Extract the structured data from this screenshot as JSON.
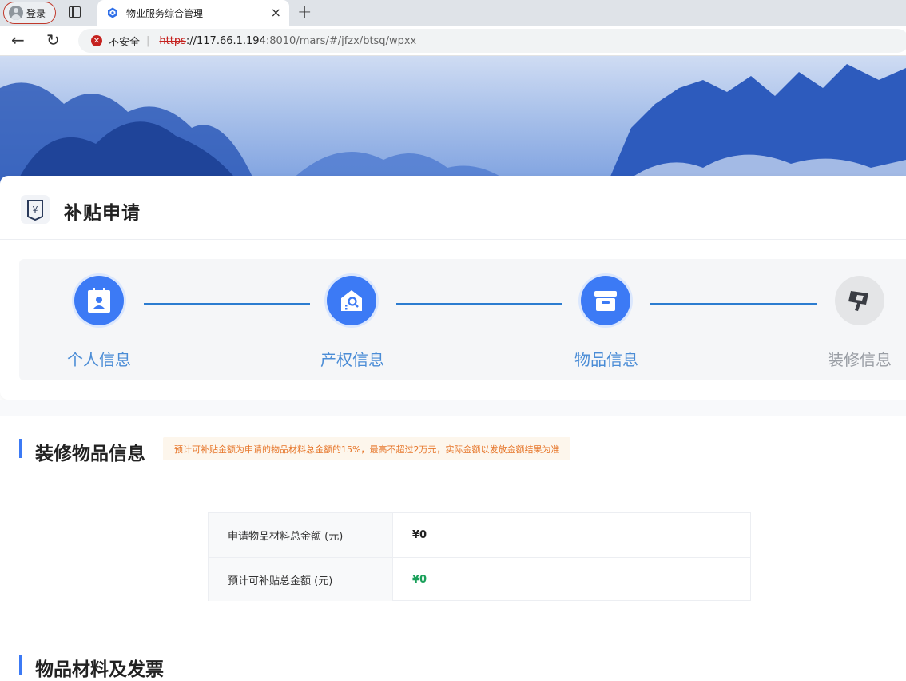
{
  "browser": {
    "login_label": "登录",
    "tab_title": "物业服务综合管理",
    "tab_close_glyph": "×",
    "new_tab_glyph": "+",
    "back_glyph": "←",
    "reload_glyph": "↻",
    "security_label": "不安全",
    "url_scheme": "https",
    "url_host": "://117.66.1.194",
    "url_path": ":8010/mars/#/jfzx/btsq/wpxx"
  },
  "page": {
    "title": "补贴申请",
    "steps": [
      {
        "label": "个人信息",
        "icon": "id-card-icon",
        "state": "active"
      },
      {
        "label": "产权信息",
        "icon": "house-search-icon",
        "state": "active"
      },
      {
        "label": "物品信息",
        "icon": "box-icon",
        "state": "active"
      },
      {
        "label": "装修信息",
        "icon": "paint-roller-icon",
        "state": "inactive"
      }
    ]
  },
  "section": {
    "title": "装修物品信息",
    "notice": "预计可补贴金额为申请的物品材料总金额的15%，最高不超过2万元，实际金额以发放金额结果为准",
    "summary": [
      {
        "label": "申请物品材料总金额 (元)",
        "value": "¥0"
      },
      {
        "label": "预计可补贴总金额 (元)",
        "value": "¥0"
      }
    ]
  },
  "section2": {
    "title": "物品材料及发票"
  },
  "colors": {
    "accent": "#3c7af5",
    "step_label": "#4a8cd6",
    "notice_text": "#e6762a",
    "amount_green": "#1aa05a"
  }
}
